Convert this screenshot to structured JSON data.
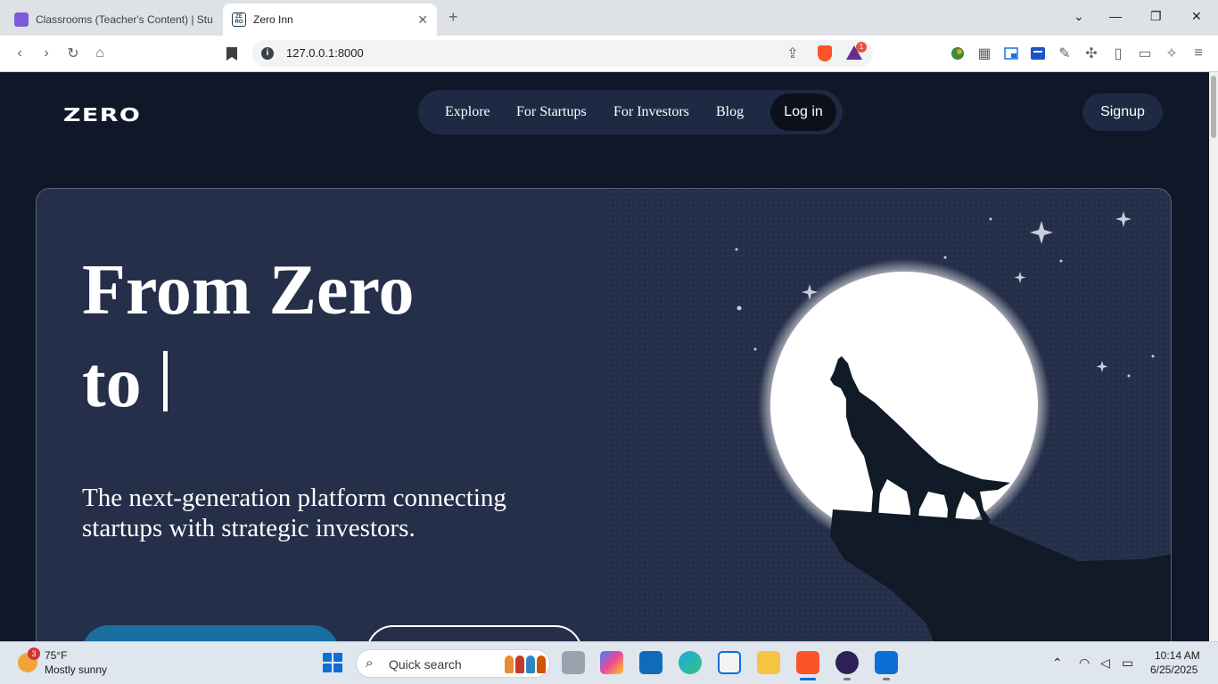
{
  "browser": {
    "tabs": [
      {
        "title": "Classrooms (Teacher's Content) | Stud",
        "active": false
      },
      {
        "title": "Zero Inn",
        "active": true
      }
    ],
    "new_tab": "+",
    "url": "127.0.0.1:8000",
    "shield_badge": "1",
    "colors": {
      "tab_bar": "#dee1e6",
      "brave_orange": "#fb542b"
    }
  },
  "site": {
    "logo": "ZERO",
    "nav": [
      "Explore",
      "For Startups",
      "For Investors",
      "Blog"
    ],
    "login": "Log in",
    "signup": "Signup",
    "hero": {
      "title_line1": "From Zero",
      "title_line2": "to",
      "subtitle": "The next-generation platform connecting startups with strategic investors."
    },
    "colors": {
      "page_bg": "#0f1729",
      "hero_bg": "#252f4a",
      "nav_bg": "#1e2a44",
      "cta_primary": "#1a6fa0"
    }
  },
  "taskbar": {
    "weather": {
      "temp": "75°F",
      "desc": "Mostly sunny",
      "badge": "3"
    },
    "search_placeholder": "Quick search",
    "clock": {
      "time": "10:14 AM",
      "date": "6/25/2025"
    }
  }
}
